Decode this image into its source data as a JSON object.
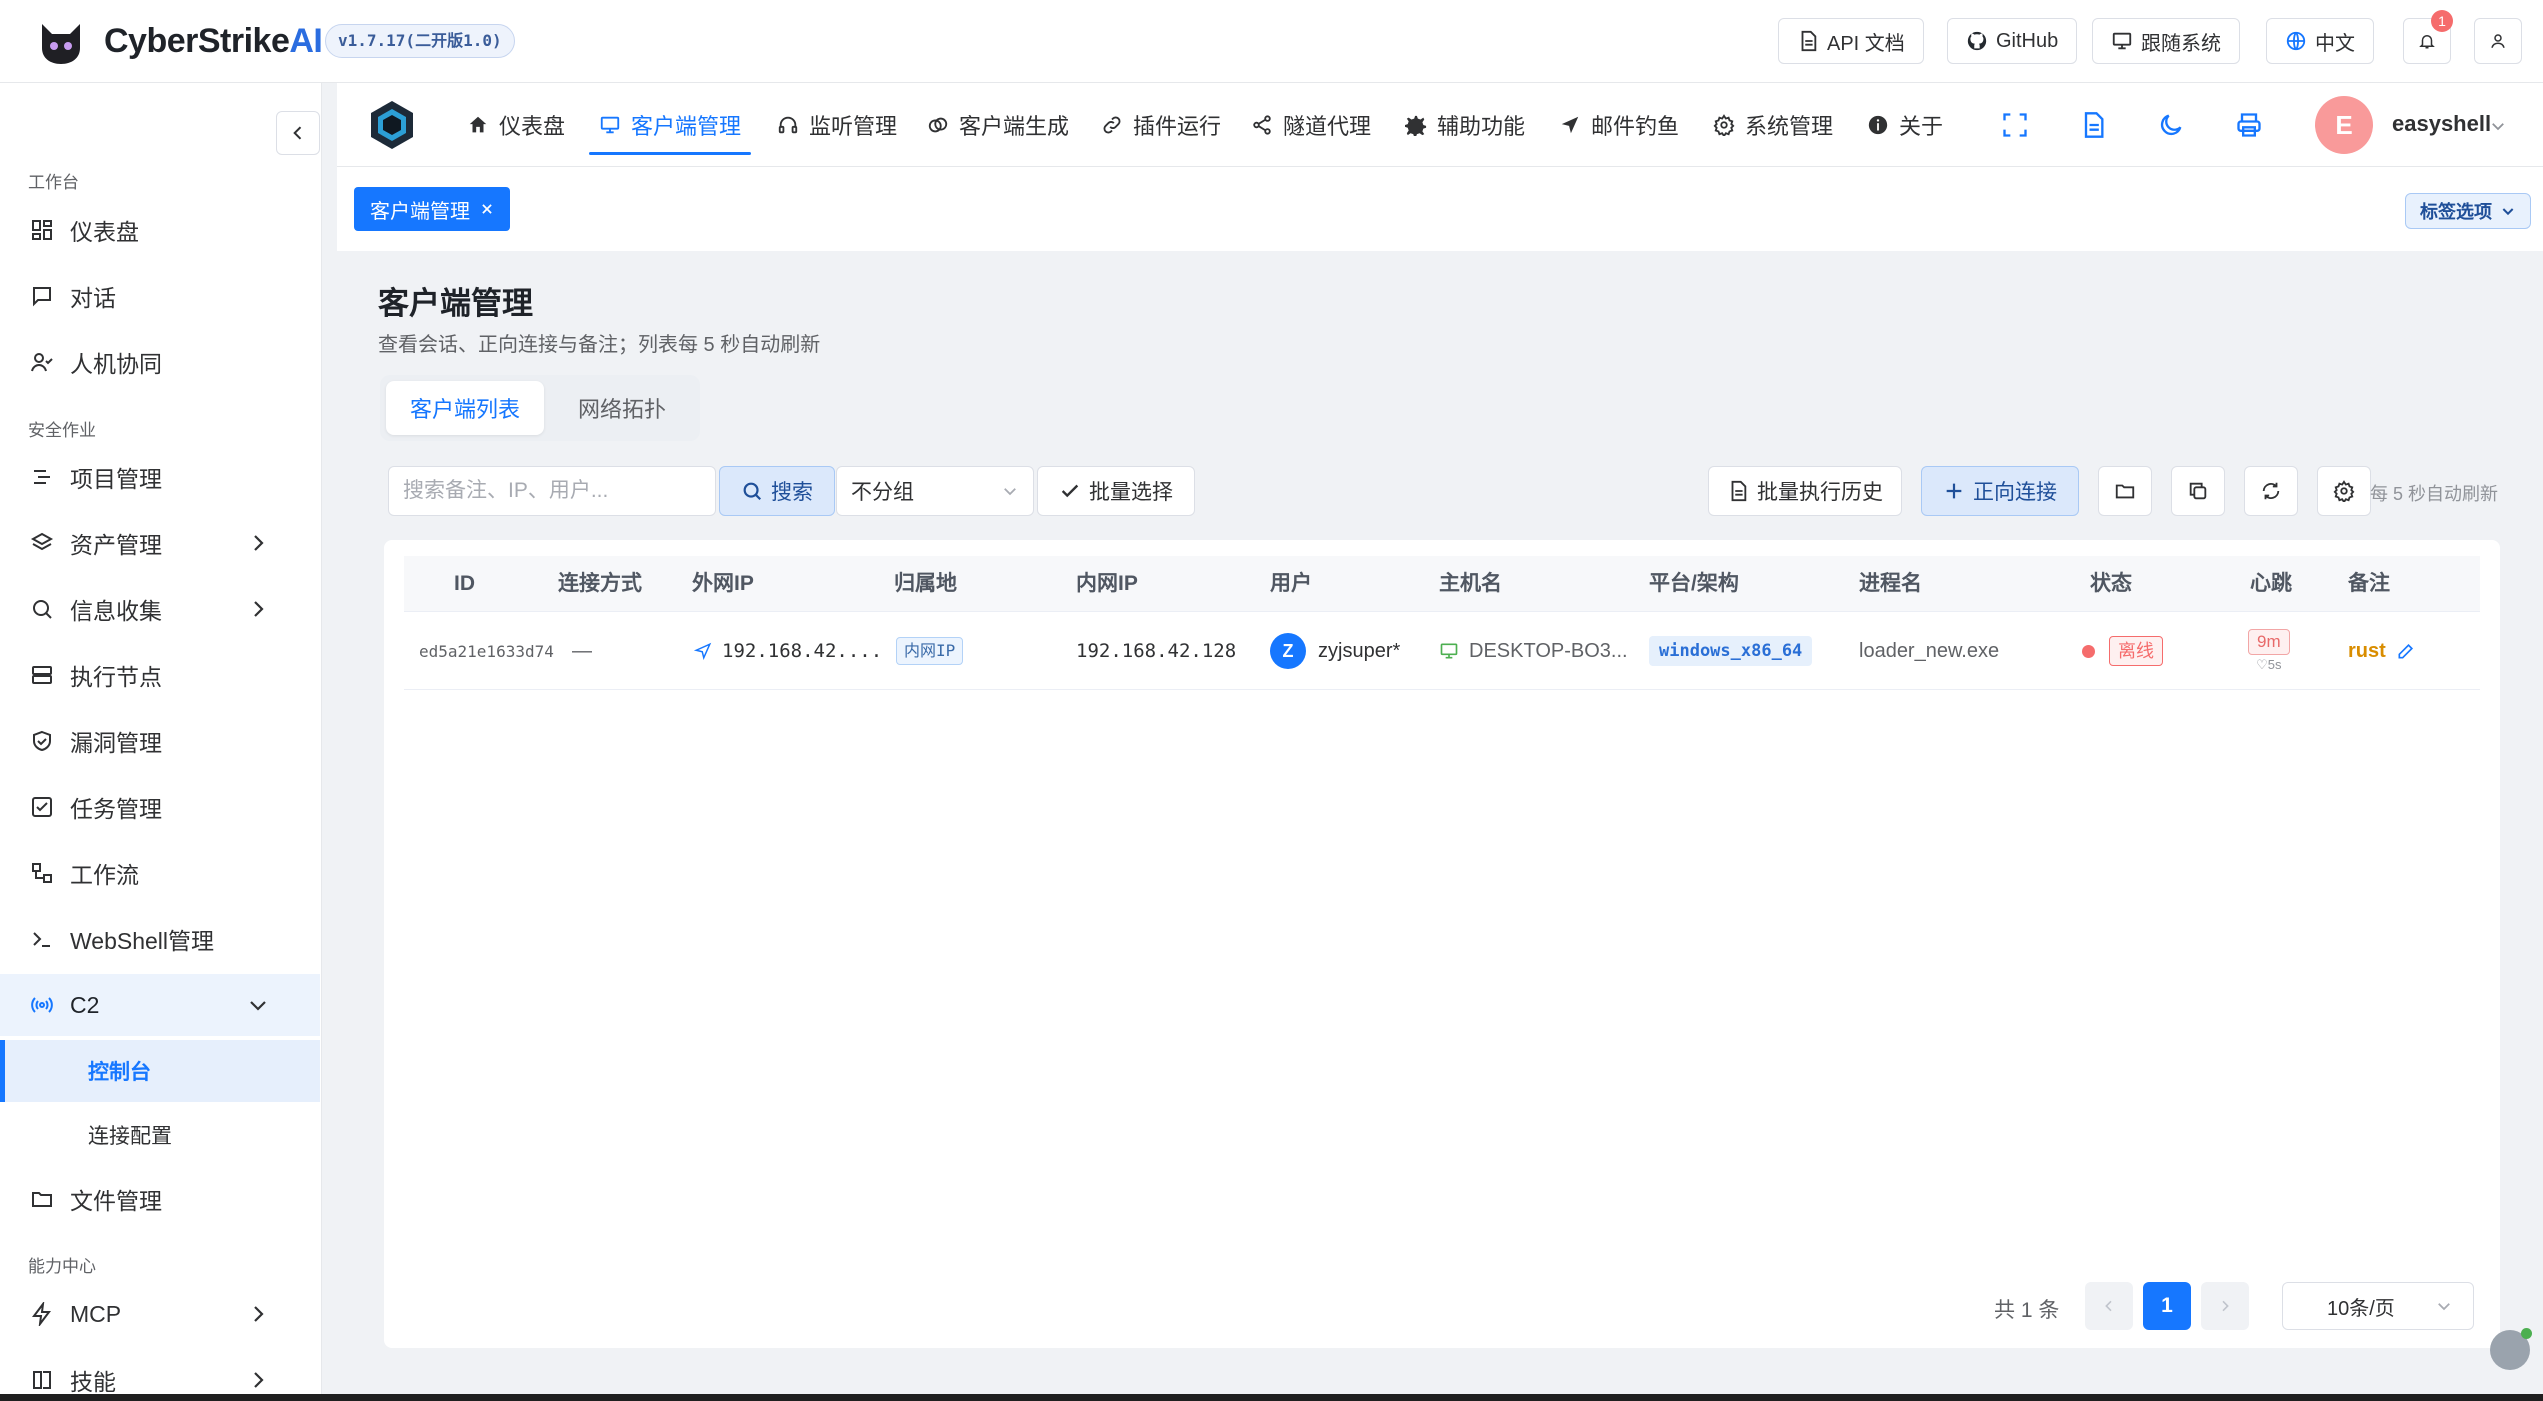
{
  "app": {
    "brand_main": "CyberStrike",
    "brand_ai": "AI",
    "version": "v1.7.17(二开版1.0)"
  },
  "topbar": {
    "api_docs": "API 文档",
    "github": "GitHub",
    "follow_system": "跟随系统",
    "language": "中文",
    "notification_count": "1"
  },
  "sidebar": {
    "sections": {
      "workbench": "工作台",
      "security_ops": "安全作业",
      "capability": "能力中心"
    },
    "items": {
      "dashboard": "仪表盘",
      "chat": "对话",
      "hitl": "人机协同",
      "projects": "项目管理",
      "assets": "资产管理",
      "recon": "信息收集",
      "exec_nodes": "执行节点",
      "vulns": "漏洞管理",
      "tasks": "任务管理",
      "workflow": "工作流",
      "webshell": "WebShell管理",
      "c2": "C2",
      "c2_console": "控制台",
      "c2_conn_config": "连接配置",
      "files": "文件管理",
      "mcp": "MCP",
      "skills": "技能"
    }
  },
  "modnav": {
    "tabs": [
      "仪表盘",
      "客户端管理",
      "监听管理",
      "客户端生成",
      "插件运行",
      "隧道代理",
      "辅助功能",
      "邮件钓鱼",
      "系统管理",
      "关于"
    ],
    "active_tab": "客户端管理",
    "avatar_letter": "E",
    "username": "easyshell"
  },
  "tagstrip": {
    "open_tag": "客户端管理",
    "tag_options": "标签选项"
  },
  "page": {
    "title": "客户端管理",
    "subtitle": "查看会话、正向连接与备注；列表每 5 秒自动刷新",
    "segments": [
      "客户端列表",
      "网络拓扑"
    ],
    "active_segment": "客户端列表"
  },
  "toolbar": {
    "search_placeholder": "搜索备注、IP、用户...",
    "search_button": "搜索",
    "group_select": "不分组",
    "batch_select": "批量选择",
    "batch_history": "批量执行历史",
    "forward_connect": "正向连接",
    "auto_refresh": "每 5 秒自动刷新"
  },
  "table": {
    "headers": [
      "ID",
      "连接方式",
      "外网IP",
      "归属地",
      "内网IP",
      "用户",
      "主机名",
      "平台/架构",
      "进程名",
      "状态",
      "心跳",
      "备注"
    ],
    "rows": [
      {
        "id": "ed5a21e1633d74",
        "conn": "—",
        "public_ip": "192.168.42....",
        "location": "内网IP",
        "private_ip": "192.168.42.128",
        "user_initial": "Z",
        "user": "zyjsuper*",
        "hostname": "DESKTOP-BO3...",
        "platform": "windows_x86_64",
        "process": "loader_new.exe",
        "status": "离线",
        "heartbeat": "9m",
        "heartbeat_interval": "♡5s",
        "note": "rust"
      }
    ]
  },
  "pager": {
    "total": "共 1 条",
    "current_page": "1",
    "page_size": "10条/页"
  },
  "colors": {
    "primary": "#1677ff",
    "offline": "#f56c6c",
    "note": "#d98d00"
  }
}
